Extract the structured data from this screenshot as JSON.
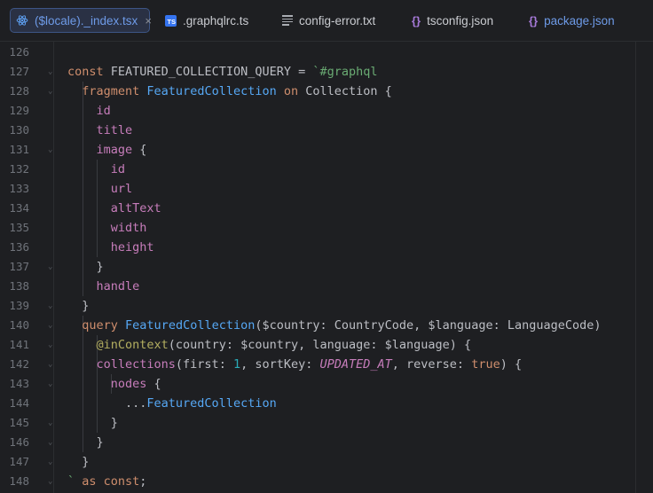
{
  "tabs": [
    {
      "label": "($locale)._index.tsx",
      "icon": "react-icon",
      "active": true
    },
    {
      "label": ".graphqlrc.ts",
      "icon": "typescript-icon",
      "active": false
    },
    {
      "label": "config-error.txt",
      "icon": "text-file-icon",
      "active": false
    },
    {
      "label": "tsconfig.json",
      "icon": "json-icon",
      "active": false
    },
    {
      "label": "package.json",
      "icon": "json-icon",
      "active": false
    }
  ],
  "close_glyph": "×",
  "ts_badge": "TS",
  "json_glyph": "{}",
  "colors": {
    "background": "#1e1f22",
    "active_tab_bg": "#2a3144",
    "active_tab_border": "#3d5585",
    "keyword": "#cf8e6d",
    "type": "#56a8f5",
    "field": "#c77dbb",
    "string": "#6aab73",
    "number": "#2aacb8",
    "line_number": "#6f737a"
  },
  "lines": [
    {
      "number": "126",
      "tokens": []
    },
    {
      "number": "127",
      "fold": true,
      "tokens": [
        [
          "kw",
          "const "
        ],
        [
          "pl",
          "FEATURED_COLLECTION_QUERY = "
        ],
        [
          "st",
          "`#graphql"
        ]
      ]
    },
    {
      "number": "128",
      "fold": true,
      "tokens": [
        [
          "pl",
          "  "
        ],
        [
          "kw",
          "fragment "
        ],
        [
          "ty",
          "FeaturedCollection "
        ],
        [
          "kw",
          "on "
        ],
        [
          "pl",
          "Collection {"
        ]
      ]
    },
    {
      "number": "129",
      "tokens": [
        [
          "pl",
          "    "
        ],
        [
          "fd",
          "id"
        ]
      ]
    },
    {
      "number": "130",
      "tokens": [
        [
          "pl",
          "    "
        ],
        [
          "fd",
          "title"
        ]
      ]
    },
    {
      "number": "131",
      "fold": true,
      "tokens": [
        [
          "pl",
          "    "
        ],
        [
          "fd",
          "image"
        ],
        [
          "pl",
          " {"
        ]
      ]
    },
    {
      "number": "132",
      "tokens": [
        [
          "pl",
          "      "
        ],
        [
          "fd",
          "id"
        ]
      ]
    },
    {
      "number": "133",
      "tokens": [
        [
          "pl",
          "      "
        ],
        [
          "fd",
          "url"
        ]
      ]
    },
    {
      "number": "134",
      "tokens": [
        [
          "pl",
          "      "
        ],
        [
          "fd",
          "altText"
        ]
      ]
    },
    {
      "number": "135",
      "tokens": [
        [
          "pl",
          "      "
        ],
        [
          "fd",
          "width"
        ]
      ]
    },
    {
      "number": "136",
      "tokens": [
        [
          "pl",
          "      "
        ],
        [
          "fd",
          "height"
        ]
      ]
    },
    {
      "number": "137",
      "fold": true,
      "tokens": [
        [
          "pl",
          "    }"
        ]
      ]
    },
    {
      "number": "138",
      "tokens": [
        [
          "pl",
          "    "
        ],
        [
          "fd",
          "handle"
        ]
      ]
    },
    {
      "number": "139",
      "fold": true,
      "tokens": [
        [
          "pl",
          "  }"
        ]
      ]
    },
    {
      "number": "140",
      "fold": true,
      "tokens": [
        [
          "pl",
          "  "
        ],
        [
          "kw",
          "query "
        ],
        [
          "ty",
          "FeaturedCollection"
        ],
        [
          "pl",
          "($country: CountryCode, $language: LanguageCode)"
        ]
      ]
    },
    {
      "number": "141",
      "fold": true,
      "tokens": [
        [
          "pl",
          "    "
        ],
        [
          "an",
          "@inContext"
        ],
        [
          "pl",
          "(country: $country, language: $language) {"
        ]
      ]
    },
    {
      "number": "142",
      "fold": true,
      "tokens": [
        [
          "pl",
          "    "
        ],
        [
          "fd",
          "collections"
        ],
        [
          "pl",
          "(first: "
        ],
        [
          "nm",
          "1"
        ],
        [
          "pl",
          ", sortKey: "
        ],
        [
          "en",
          "UPDATED_AT"
        ],
        [
          "pl",
          ", reverse: "
        ],
        [
          "kw",
          "true"
        ],
        [
          "pl",
          ") {"
        ]
      ]
    },
    {
      "number": "143",
      "fold": true,
      "tokens": [
        [
          "pl",
          "      "
        ],
        [
          "fd",
          "nodes"
        ],
        [
          "pl",
          " {"
        ]
      ]
    },
    {
      "number": "144",
      "tokens": [
        [
          "pl",
          "        ..."
        ],
        [
          "ty",
          "FeaturedCollection"
        ]
      ]
    },
    {
      "number": "145",
      "fold": true,
      "tokens": [
        [
          "pl",
          "      }"
        ]
      ]
    },
    {
      "number": "146",
      "fold": true,
      "tokens": [
        [
          "pl",
          "    }"
        ]
      ]
    },
    {
      "number": "147",
      "fold": true,
      "tokens": [
        [
          "pl",
          "  }"
        ]
      ]
    },
    {
      "number": "148",
      "fold": true,
      "tokens": [
        [
          "st",
          "` "
        ],
        [
          "kw",
          "as const"
        ],
        [
          "pl",
          ";"
        ]
      ]
    }
  ]
}
